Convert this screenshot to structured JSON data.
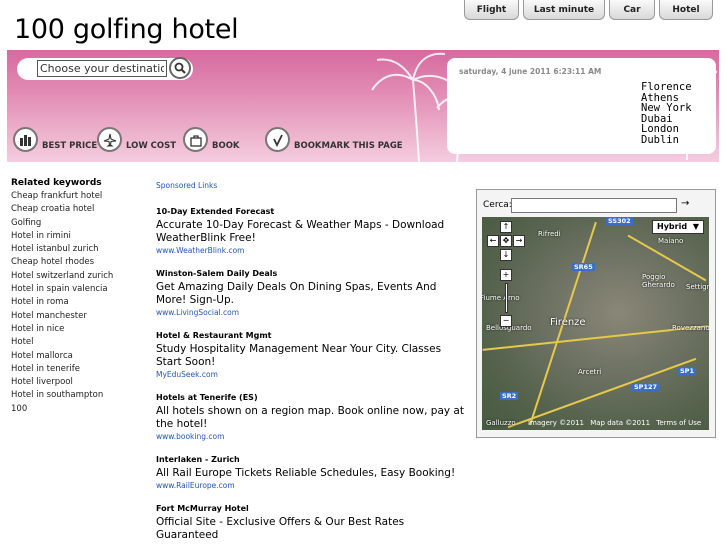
{
  "tabs": [
    "Flight",
    "Last minute",
    "Car",
    "Hotel"
  ],
  "site_title": "100 golfing hotel",
  "search": {
    "placeholder": "Choose your destination"
  },
  "datetime": "saturday, 4 june 2011 6:23:11 AM",
  "cities": [
    "Florence",
    "Athens",
    "New York",
    "Dubai",
    "London",
    "Dublin"
  ],
  "features": [
    {
      "label": "BEST PRICE",
      "icon": "bar-chart-icon"
    },
    {
      "label": "LOW COST",
      "icon": "airplane-icon"
    },
    {
      "label": "BOOK",
      "icon": "bag-icon"
    },
    {
      "label": "BOOKMARK THIS PAGE",
      "icon": "check-icon"
    }
  ],
  "keywords": {
    "title": "Related keywords",
    "items": [
      "Cheap frankfurt hotel",
      "Cheap croatia hotel",
      "Golfing",
      "Hotel in rimini",
      "Hotel istanbul zurich",
      "Cheap hotel rhodes",
      "Hotel switzerland zurich",
      "Hotel in spain valencia",
      "Hotel in roma",
      "Hotel manchester",
      "Hotel in nice",
      "Hotel",
      "Hotel mallorca",
      "Hotel in tenerife",
      "Hotel liverpool",
      "Hotel in southampton",
      "100"
    ]
  },
  "sponsored_label": "Sponsored Links",
  "ads": [
    {
      "title": "10-Day Extended Forecast",
      "text": "Accurate 10-Day Forecast & Weather Maps - Download WeatherBlink Free!",
      "url": "www.WeatherBlink.com"
    },
    {
      "title": "Winston-Salem Daily Deals",
      "text": "Get Amazing Daily Deals On Dining Spas, Events And More! Sign-Up.",
      "url": "www.LivingSocial.com"
    },
    {
      "title": "Hotel & Restaurant Mgmt",
      "text": "Study Hospitality Management Near Your City. Classes Start Soon!",
      "url": "MyEduSeek.com"
    },
    {
      "title": "Hotels at Tenerife (ES)",
      "text": "All hotels shown on a region map. Book online now, pay at the hotel!",
      "url": "www.booking.com"
    },
    {
      "title": "Interlaken - Zurich",
      "text": "All Rail Europe Tickets Reliable Schedules, Easy Booking!",
      "url": "www.RailEurope.com"
    },
    {
      "title": "Fort McMurray Hotel",
      "text": "Official Site - Exclusive Offers & Our Best Rates Guaranteed",
      "url": ""
    }
  ],
  "map": {
    "cerca_label": "Cerca:",
    "go_symbol": "→",
    "type_button": "Hybrid",
    "places": [
      "Rifredi",
      "Maiano",
      "Poggio Gherardo",
      "Settign",
      "Fiume Arno",
      "Firenze",
      "Bellosguardo",
      "Rovezzano",
      "Arcetri",
      "Galluzzo"
    ],
    "routes": [
      "SS302",
      "SR65",
      "SP127",
      "SP1",
      "SR2"
    ],
    "footer": [
      "Imagery ©2011",
      "Map data ©2011",
      "Terms of Use"
    ]
  }
}
